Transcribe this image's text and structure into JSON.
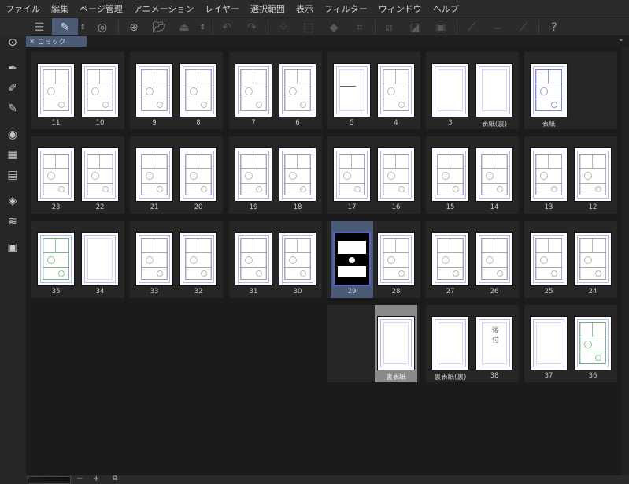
{
  "menu": [
    "ファイル",
    "編集",
    "ページ管理",
    "アニメーション",
    "レイヤー",
    "選択範囲",
    "表示",
    "フィルター",
    "ウィンドウ",
    "ヘルプ"
  ],
  "nav": {
    "back": "«",
    "forward": "›"
  },
  "tab": {
    "close": "×",
    "label": "コミック"
  },
  "bottom": {
    "minus": "−",
    "plus": "+"
  },
  "rows": [
    [
      {
        "l": {
          "label": "11",
          "art": "sketch"
        },
        "r": {
          "label": "10",
          "art": "sketch"
        }
      },
      {
        "l": {
          "label": "9",
          "art": "sketch"
        },
        "r": {
          "label": "8",
          "art": "sketch"
        }
      },
      {
        "l": {
          "label": "7",
          "art": "sketch"
        },
        "r": {
          "label": "6",
          "art": "sketch"
        }
      },
      {
        "l": {
          "label": "5",
          "art": "text"
        },
        "r": {
          "label": "4",
          "art": "sketch"
        }
      },
      {
        "l": {
          "label": "3",
          "art": "blank"
        },
        "r": {
          "label": "表紙(裏)",
          "art": "blank"
        }
      },
      {
        "l": {
          "label": "表紙",
          "art": "blue"
        },
        "r": null
      }
    ],
    [
      {
        "l": {
          "label": "23",
          "art": "sketch"
        },
        "r": {
          "label": "22",
          "art": "sketch"
        }
      },
      {
        "l": {
          "label": "21",
          "art": "sketch"
        },
        "r": {
          "label": "20",
          "art": "sketch"
        }
      },
      {
        "l": {
          "label": "19",
          "art": "sketch"
        },
        "r": {
          "label": "18",
          "art": "sketch"
        }
      },
      {
        "l": {
          "label": "17",
          "art": "sketch"
        },
        "r": {
          "label": "16",
          "art": "sketch"
        }
      },
      {
        "l": {
          "label": "15",
          "art": "sketch"
        },
        "r": {
          "label": "14",
          "art": "sketch"
        }
      },
      {
        "l": {
          "label": "13",
          "art": "sketch"
        },
        "r": {
          "label": "12",
          "art": "sketch"
        }
      }
    ],
    [
      {
        "l": {
          "label": "35",
          "art": "green"
        },
        "r": {
          "label": "34",
          "art": "blank"
        }
      },
      {
        "l": {
          "label": "33",
          "art": "sketch"
        },
        "r": {
          "label": "32",
          "art": "sketch"
        }
      },
      {
        "l": {
          "label": "31",
          "art": "sketch"
        },
        "r": {
          "label": "30",
          "art": "sketch"
        }
      },
      {
        "l": {
          "label": "29",
          "art": "dark",
          "selected": "blue"
        },
        "r": {
          "label": "28",
          "art": "sketch"
        }
      },
      {
        "l": {
          "label": "27",
          "art": "sketch"
        },
        "r": {
          "label": "26",
          "art": "sketch"
        }
      },
      {
        "l": {
          "label": "25",
          "art": "sketch"
        },
        "r": {
          "label": "24",
          "art": "sketch"
        }
      }
    ],
    [
      null,
      null,
      null,
      {
        "l": null,
        "r": {
          "label": "裏表紙",
          "art": "blank",
          "selected": "gray"
        }
      },
      {
        "l": {
          "label": "裏表紙(裏)",
          "art": "blank"
        },
        "r": {
          "label": "38",
          "art": "text2"
        }
      },
      {
        "l": {
          "label": "37",
          "art": "blank"
        },
        "r": {
          "label": "36",
          "art": "green"
        }
      }
    ]
  ]
}
